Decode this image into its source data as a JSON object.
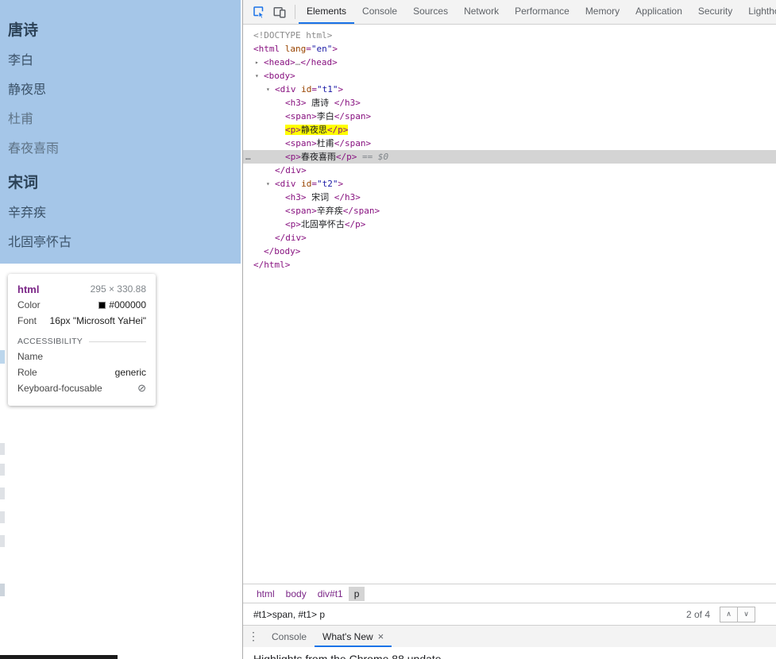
{
  "colors": {
    "accent_blue": "#1a73e8",
    "inspect_highlight_blue": "#a5c6e8",
    "selection_gray": "#d4d4d4",
    "search_match_yellow": "#ffff00",
    "syntax_tag": "#881280",
    "syntax_attr_name": "#994500",
    "syntax_attr_value": "#1a1aa6"
  },
  "icons": {
    "inspect": "inspect-cursor-icon",
    "device_toolbar": "device-toolbar-icon",
    "kebab_menu": "⋮",
    "tab_close": "×",
    "prev_match": "∧",
    "next_match": "∨",
    "not_allowed": "⊘",
    "color_swatch": "■",
    "twisty_expanded": "▾",
    "twisty_collapsed": "▸",
    "node_overflow_dots": "…"
  },
  "page": {
    "sections": [
      {
        "heading": "唐诗",
        "items": [
          {
            "text": "李白"
          },
          {
            "text": "静夜思"
          },
          {
            "text": "杜甫",
            "muted": true
          },
          {
            "text": "春夜喜雨",
            "muted": true
          }
        ]
      },
      {
        "heading": "宋词",
        "items": [
          {
            "text": "辛弃疾"
          },
          {
            "text": "北固亭怀古"
          }
        ]
      }
    ]
  },
  "tooltip": {
    "tag": "html",
    "dimensions": "295 × 330.88",
    "color_label": "Color",
    "color_value": "#000000",
    "font_label": "Font",
    "font_value": "16px \"Microsoft YaHei\"",
    "accessibility_title": "ACCESSIBILITY",
    "name_label": "Name",
    "name_value": "",
    "role_label": "Role",
    "role_value": "generic",
    "focusable_label": "Keyboard-focusable"
  },
  "devtools": {
    "tabs": [
      "Elements",
      "Console",
      "Sources",
      "Network",
      "Performance",
      "Memory",
      "Application",
      "Security",
      "Lighthouse"
    ],
    "selected_tab": "Elements",
    "tree": [
      {
        "indent": 0,
        "tokens": [
          {
            "t": "<!DOCTYPE html>",
            "c": "gray"
          }
        ]
      },
      {
        "indent": 0,
        "tokens": [
          {
            "t": "<html ",
            "c": "tag"
          },
          {
            "t": "lang",
            "c": "attr"
          },
          {
            "t": "=",
            "c": "tag"
          },
          {
            "t": "\"en\"",
            "c": "val"
          },
          {
            "t": ">",
            "c": "tag"
          }
        ]
      },
      {
        "indent": 1,
        "arrow": "collapsed",
        "tokens": [
          {
            "t": "<head>",
            "c": "tag"
          },
          {
            "t": "…",
            "c": "gray"
          },
          {
            "t": "</head>",
            "c": "tag"
          }
        ]
      },
      {
        "indent": 1,
        "arrow": "expanded",
        "tokens": [
          {
            "t": "<body>",
            "c": "tag"
          }
        ]
      },
      {
        "indent": 2,
        "arrow": "expanded",
        "tokens": [
          {
            "t": "<div ",
            "c": "tag"
          },
          {
            "t": "id",
            "c": "attr"
          },
          {
            "t": "=",
            "c": "tag"
          },
          {
            "t": "\"t1\"",
            "c": "val"
          },
          {
            "t": ">",
            "c": "tag"
          }
        ]
      },
      {
        "indent": 3,
        "tokens": [
          {
            "t": "<h3>",
            "c": "tag"
          },
          {
            "t": " 唐诗 ",
            "c": "text"
          },
          {
            "t": "</h3>",
            "c": "tag"
          }
        ]
      },
      {
        "indent": 3,
        "tokens": [
          {
            "t": "<span>",
            "c": "tag"
          },
          {
            "t": "李白",
            "c": "text"
          },
          {
            "t": "</span>",
            "c": "tag"
          }
        ]
      },
      {
        "indent": 3,
        "match": true,
        "tokens": [
          {
            "t": "<p>",
            "c": "tag"
          },
          {
            "t": "静夜思",
            "c": "text"
          },
          {
            "t": "</p>",
            "c": "tag"
          }
        ]
      },
      {
        "indent": 3,
        "tokens": [
          {
            "t": "<span>",
            "c": "tag"
          },
          {
            "t": "杜甫",
            "c": "text"
          },
          {
            "t": "</span>",
            "c": "tag"
          }
        ]
      },
      {
        "indent": 3,
        "selected": true,
        "dots": true,
        "tokens": [
          {
            "t": "<p>",
            "c": "tag"
          },
          {
            "t": "春夜喜雨",
            "c": "text"
          },
          {
            "t": "</p>",
            "c": "tag"
          },
          {
            "t": " == $0",
            "c": "meta"
          }
        ]
      },
      {
        "indent": 2,
        "tokens": [
          {
            "t": "</div>",
            "c": "tag"
          }
        ]
      },
      {
        "indent": 2,
        "arrow": "expanded",
        "tokens": [
          {
            "t": "<div ",
            "c": "tag"
          },
          {
            "t": "id",
            "c": "attr"
          },
          {
            "t": "=",
            "c": "tag"
          },
          {
            "t": "\"t2\"",
            "c": "val"
          },
          {
            "t": ">",
            "c": "tag"
          }
        ]
      },
      {
        "indent": 3,
        "tokens": [
          {
            "t": "<h3>",
            "c": "tag"
          },
          {
            "t": " 宋词 ",
            "c": "text"
          },
          {
            "t": "</h3>",
            "c": "tag"
          }
        ]
      },
      {
        "indent": 3,
        "tokens": [
          {
            "t": "<span>",
            "c": "tag"
          },
          {
            "t": "辛弃疾",
            "c": "text"
          },
          {
            "t": "</span>",
            "c": "tag"
          }
        ]
      },
      {
        "indent": 3,
        "tokens": [
          {
            "t": "<p>",
            "c": "tag"
          },
          {
            "t": "北固亭怀古",
            "c": "text"
          },
          {
            "t": "</p>",
            "c": "tag"
          }
        ]
      },
      {
        "indent": 2,
        "tokens": [
          {
            "t": "</div>",
            "c": "tag"
          }
        ]
      },
      {
        "indent": 1,
        "tokens": [
          {
            "t": "</body>",
            "c": "tag"
          }
        ]
      },
      {
        "indent": 0,
        "tokens": [
          {
            "t": "</html>",
            "c": "tag"
          }
        ]
      }
    ],
    "breadcrumbs": [
      {
        "label": "html"
      },
      {
        "label": "body"
      },
      {
        "label": "div#t1"
      },
      {
        "label": "p",
        "selected": true
      }
    ],
    "search": {
      "value": "#t1>span, #t1> p",
      "matches": "2 of 4"
    },
    "drawer": {
      "tabs": [
        {
          "label": "Console"
        },
        {
          "label": "What's New",
          "selected": true,
          "closable": true
        }
      ]
    },
    "whats_new_heading": "Highlights from the Chrome 88 update"
  }
}
